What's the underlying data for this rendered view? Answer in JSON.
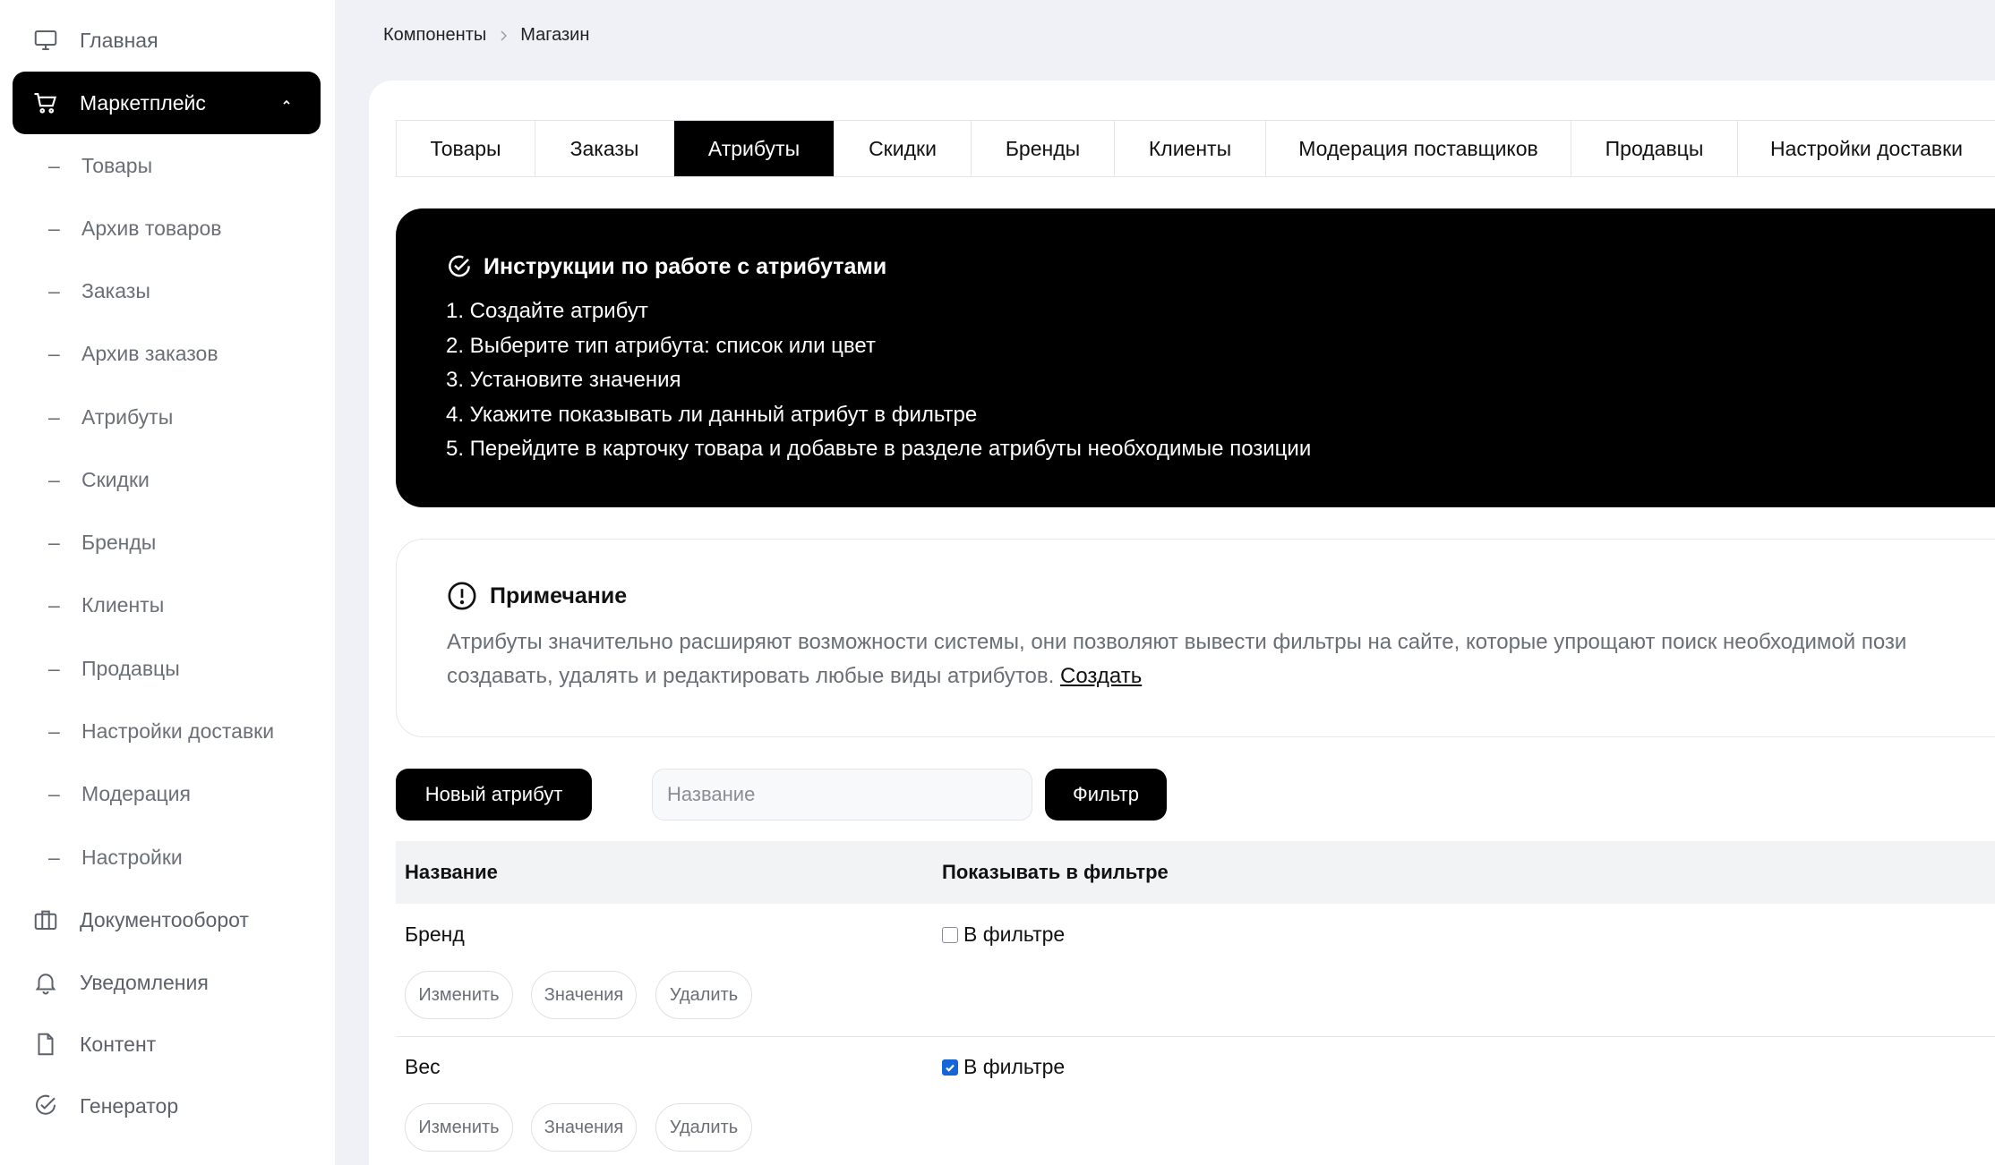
{
  "sidebar": {
    "items": [
      {
        "label": "Главная",
        "icon": "monitor-icon"
      },
      {
        "label": "Маркетплейс",
        "icon": "cart-icon",
        "active": true
      },
      {
        "label": "Документооборот",
        "icon": "briefcase-icon"
      },
      {
        "label": "Уведомления",
        "icon": "bell-icon"
      },
      {
        "label": "Контент",
        "icon": "file-icon"
      },
      {
        "label": "Генератор",
        "icon": "check-circle-icon"
      }
    ],
    "submenu": [
      "Товары",
      "Архив товаров",
      "Заказы",
      "Архив заказов",
      "Атрибуты",
      "Скидки",
      "Бренды",
      "Клиенты",
      "Продавцы",
      "Настройки доставки",
      "Модерация",
      "Настройки"
    ],
    "dash": "–"
  },
  "breadcrumb": {
    "items": [
      "Компоненты",
      "Магазин"
    ]
  },
  "tabs": [
    {
      "label": "Товары"
    },
    {
      "label": "Заказы"
    },
    {
      "label": "Атрибуты",
      "active": true
    },
    {
      "label": "Скидки"
    },
    {
      "label": "Бренды"
    },
    {
      "label": "Клиенты"
    },
    {
      "label": "Модерация поставщиков"
    },
    {
      "label": "Продавцы"
    },
    {
      "label": "Настройки доставки"
    }
  ],
  "instructions": {
    "title": "Инструкции по работе с атрибутами",
    "steps": [
      "1. Создайте атрибут",
      "2. Выберите тип атрибута: список или цвет",
      "3. Установите значения",
      "4. Укажите показывать ли данный атрибут в фильтре",
      "5. Перейдите в карточку товара и добавьте в разделе атрибуты необходимые позиции"
    ]
  },
  "note": {
    "title": "Примечание",
    "line1": "Атрибуты значительно расширяют возможности системы, они позволяют вывести фильтры на сайте, которые упрощают поиск необходимой пози",
    "line2": "создавать, удалять и редактировать любые виды атрибутов. ",
    "link": "Создать"
  },
  "toolbar": {
    "new_label": "Новый атрибут",
    "search_placeholder": "Название",
    "filter_label": "Фильтр"
  },
  "table": {
    "headers": [
      "Название",
      "Показывать в фильтре"
    ],
    "rows": [
      {
        "name": "Бренд",
        "filter_label": "В фильтре",
        "checked": false
      },
      {
        "name": "Вес",
        "filter_label": "В фильтре",
        "checked": true
      }
    ],
    "actions": [
      "Изменить",
      "Значения",
      "Удалить"
    ]
  }
}
